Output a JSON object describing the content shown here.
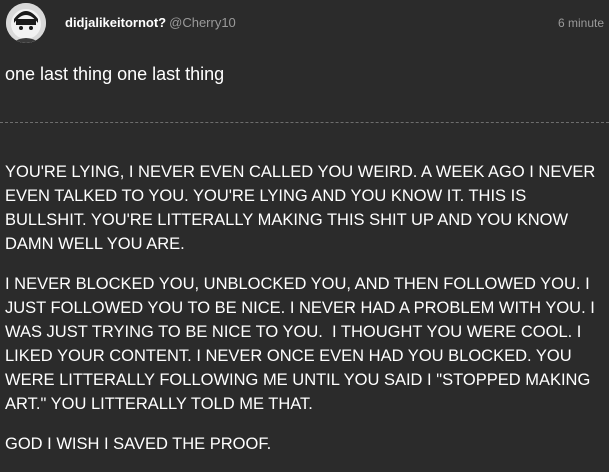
{
  "post": {
    "author": {
      "display_name": "didjalikeitornot?",
      "handle": "@Cherry10",
      "avatar_icon": "avatar-image"
    },
    "timestamp": "6 minute",
    "title": "one last thing one last thing",
    "paragraphs": [
      "YOU'RE LYING, I NEVER EVEN CALLED YOU WEIRD. A WEEK AGO I NEVER EVEN TALKED TO YOU. YOU'RE LYING AND YOU KNOW IT. THIS IS BULLSHIT. YOU'RE LITTERALLY MAKING THIS SHIT UP AND YOU KNOW DAMN WELL YOU ARE.",
      "I NEVER BLOCKED YOU, UNBLOCKED YOU, AND THEN FOLLOWED YOU. I JUST FOLLOWED YOU TO BE NICE. I NEVER HAD A PROBLEM WITH YOU. I WAS JUST TRYING TO BE NICE TO YOU.  I THOUGHT YOU WERE COOL. I LIKED YOUR CONTENT. I NEVER ONCE EVEN HAD YOU BLOCKED. YOU WERE LITTERALLY FOLLOWING ME UNTIL YOU SAID I \"STOPPED MAKING ART.\" YOU LITTERALLY TOLD ME THAT.",
      "GOD I WISH I SAVED THE PROOF."
    ]
  },
  "colors": {
    "background": "#2b2b2b",
    "text": "#ffffff",
    "muted": "#9a9a9a",
    "divider": "#6e6e6e"
  }
}
